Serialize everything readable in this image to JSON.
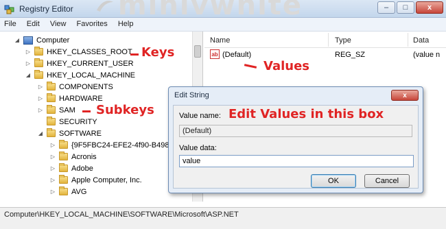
{
  "window": {
    "title": "Registry Editor",
    "watermark": "minivwhite",
    "minimize_glyph": "–",
    "maximize_glyph": "□",
    "close_glyph": "x"
  },
  "menu": [
    "File",
    "Edit",
    "View",
    "Favorites",
    "Help"
  ],
  "tree": {
    "root": "Computer",
    "items": [
      {
        "label": "HKEY_CLASSES_ROOT",
        "icon": "folder-icon"
      },
      {
        "label": "HKEY_CURRENT_USER",
        "icon": "folder-icon"
      },
      {
        "label": "HKEY_LOCAL_MACHINE",
        "icon": "folder-icon"
      },
      {
        "label": "COMPONENTS",
        "icon": "folder-icon"
      },
      {
        "label": "HARDWARE",
        "icon": "folder-icon"
      },
      {
        "label": "SAM",
        "icon": "folder-icon"
      },
      {
        "label": "SECURITY",
        "icon": "folder-icon"
      },
      {
        "label": "SOFTWARE",
        "icon": "folder-icon"
      },
      {
        "label": "{9F5FBC24-EFE2-4f90-B498-",
        "icon": "folder-icon"
      },
      {
        "label": "Acronis",
        "icon": "folder-icon"
      },
      {
        "label": "Adobe",
        "icon": "folder-icon"
      },
      {
        "label": "Apple Computer, Inc.",
        "icon": "folder-icon"
      },
      {
        "label": "AVG",
        "icon": "folder-icon"
      }
    ]
  },
  "list": {
    "columns": [
      "Name",
      "Type",
      "Data"
    ],
    "rows": [
      {
        "name": "(Default)",
        "type": "REG_SZ",
        "data": "(value n"
      }
    ]
  },
  "annotations": {
    "keys": "Keys",
    "values": "Values",
    "subkeys": "Subkeys",
    "edit": "Edit Values in this box",
    "color": "#e02424"
  },
  "dialog": {
    "title": "Edit String",
    "close_glyph": "x",
    "value_name_label": "Value name:",
    "value_name": "(Default)",
    "value_data_label": "Value data:",
    "value_data": "value",
    "ok": "OK",
    "cancel": "Cancel"
  },
  "status": "Computer\\HKEY_LOCAL_MACHINE\\SOFTWARE\\Microsoft\\ASP.NET"
}
